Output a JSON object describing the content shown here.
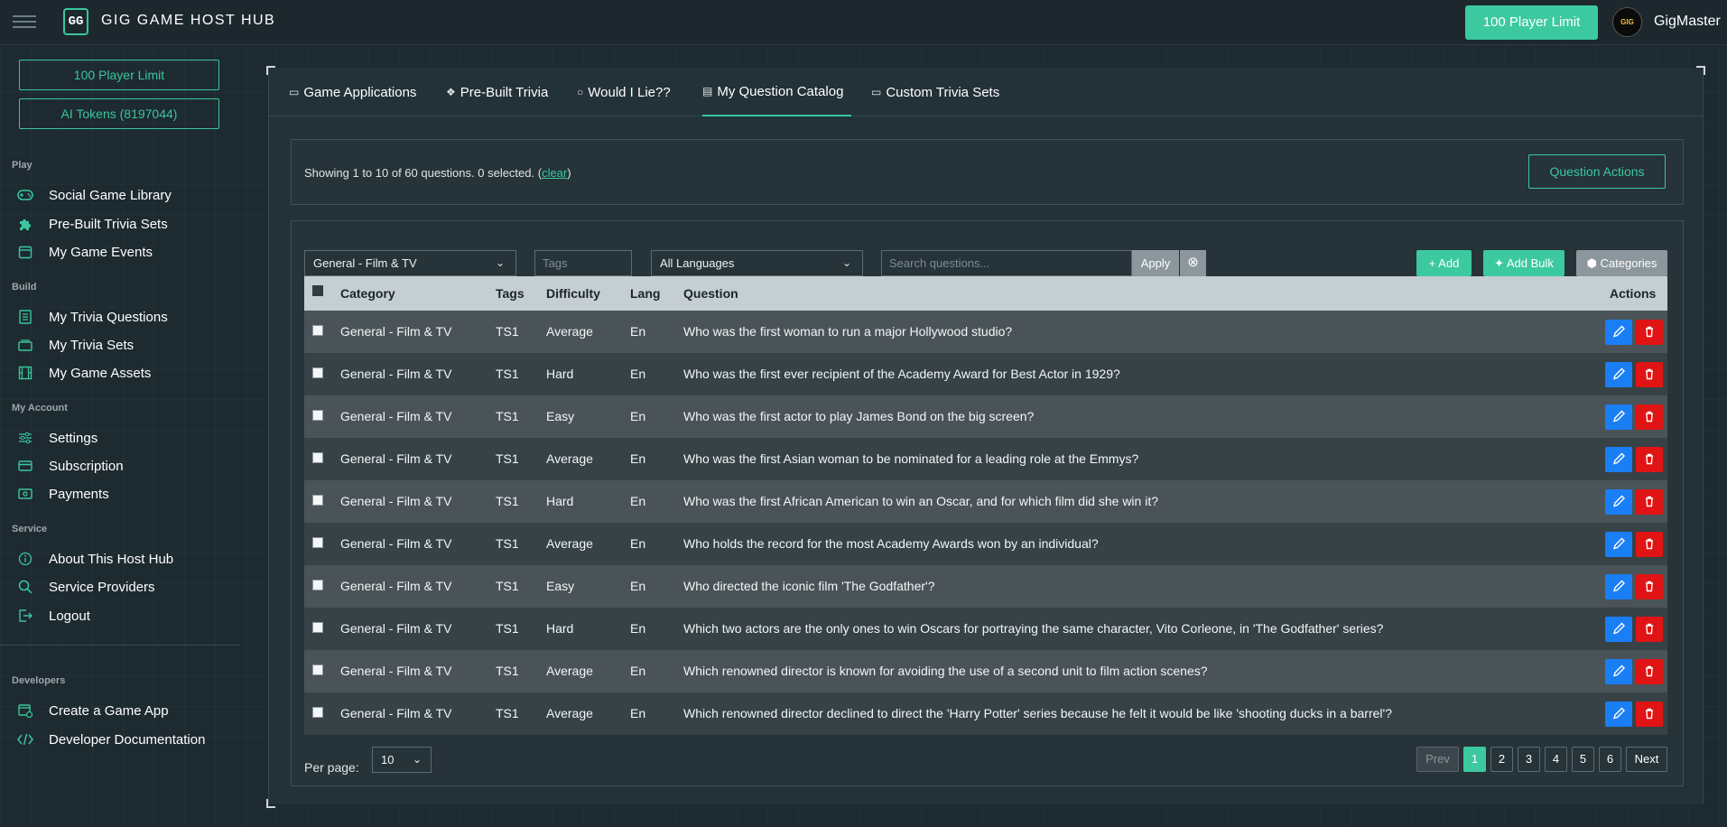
{
  "header": {
    "logo_text": "GG",
    "brand": "GIG GAME HOST HUB",
    "player_limit": "100 Player Limit",
    "avatar_text": "GIG",
    "username": "GigMaster"
  },
  "sidebar": {
    "player_limit": "100 Player Limit",
    "ai_tokens": "AI Tokens (8197044)",
    "sections": {
      "play": "Play",
      "build": "Build",
      "account": "My Account",
      "service": "Service",
      "developers": "Developers"
    },
    "items": {
      "social_game_library": "Social Game Library",
      "prebuilt_trivia_sets": "Pre-Built Trivia Sets",
      "my_game_events": "My Game Events",
      "my_trivia_questions": "My Trivia Questions",
      "my_trivia_sets": "My Trivia Sets",
      "my_game_assets": "My Game Assets",
      "settings": "Settings",
      "subscription": "Subscription",
      "payments": "Payments",
      "about": "About This Host Hub",
      "service_providers": "Service Providers",
      "logout": "Logout",
      "create_game_app": "Create a Game App",
      "developer_docs": "Developer Documentation"
    }
  },
  "tabs": [
    {
      "label": "Game Applications",
      "icon": "gamepad-icon"
    },
    {
      "label": "Pre-Built Trivia",
      "icon": "puzzle-icon"
    },
    {
      "label": "Would I Lie??",
      "icon": "chat-icon"
    },
    {
      "label": "My Question Catalog",
      "icon": "catalog-icon",
      "active": true
    },
    {
      "label": "Custom Trivia Sets",
      "icon": "folder-icon"
    }
  ],
  "info": {
    "text": "Showing 1 to 10 of 60 questions. 0 selected. (",
    "clear": "clear",
    "close": ")",
    "actions_label": "Question Actions"
  },
  "filters": {
    "category_selected": "General - Film & TV",
    "tags_placeholder": "Tags",
    "language_selected": "All Languages",
    "search_placeholder": "Search questions...",
    "apply_label": "Apply",
    "add_label": "Add",
    "add_bulk_label": "Add Bulk",
    "categories_label": "Categories"
  },
  "table": {
    "columns": {
      "category": "Category",
      "tags": "Tags",
      "difficulty": "Difficulty",
      "lang": "Lang",
      "question": "Question",
      "actions": "Actions"
    },
    "rows": [
      {
        "category": "General - Film & TV",
        "tags": "TS1",
        "difficulty": "Average",
        "lang": "En",
        "question": "Who was the first woman to run a major Hollywood studio?"
      },
      {
        "category": "General - Film & TV",
        "tags": "TS1",
        "difficulty": "Hard",
        "lang": "En",
        "question": "Who was the first ever recipient of the Academy Award for Best Actor in 1929?"
      },
      {
        "category": "General - Film & TV",
        "tags": "TS1",
        "difficulty": "Easy",
        "lang": "En",
        "question": "Who was the first actor to play James Bond on the big screen?"
      },
      {
        "category": "General - Film & TV",
        "tags": "TS1",
        "difficulty": "Average",
        "lang": "En",
        "question": "Who was the first Asian woman to be nominated for a leading role at the Emmys?"
      },
      {
        "category": "General - Film & TV",
        "tags": "TS1",
        "difficulty": "Hard",
        "lang": "En",
        "question": "Who was the first African American to win an Oscar, and for which film did she win it?"
      },
      {
        "category": "General - Film & TV",
        "tags": "TS1",
        "difficulty": "Average",
        "lang": "En",
        "question": "Who holds the record for the most Academy Awards won by an individual?"
      },
      {
        "category": "General - Film & TV",
        "tags": "TS1",
        "difficulty": "Easy",
        "lang": "En",
        "question": "Who directed the iconic film 'The Godfather'?"
      },
      {
        "category": "General - Film & TV",
        "tags": "TS1",
        "difficulty": "Hard",
        "lang": "En",
        "question": "Which two actors are the only ones to win Oscars for portraying the same character, Vito Corleone, in 'The Godfather' series?"
      },
      {
        "category": "General - Film & TV",
        "tags": "TS1",
        "difficulty": "Average",
        "lang": "En",
        "question": "Which renowned director is known for avoiding the use of a second unit to film action scenes?"
      },
      {
        "category": "General - Film & TV",
        "tags": "TS1",
        "difficulty": "Average",
        "lang": "En",
        "question": "Which renowned director declined to direct the 'Harry Potter' series because he felt it would be like 'shooting ducks in a barrel'?"
      }
    ]
  },
  "pagination": {
    "per_page_label": "Per page:",
    "per_page_value": "10",
    "prev": "Prev",
    "pages": [
      "1",
      "2",
      "3",
      "4",
      "5",
      "6"
    ],
    "next": "Next",
    "current": "1"
  },
  "colors": {
    "accent": "#3cc9a0",
    "edit": "#1a7ef5",
    "delete": "#e01414"
  }
}
